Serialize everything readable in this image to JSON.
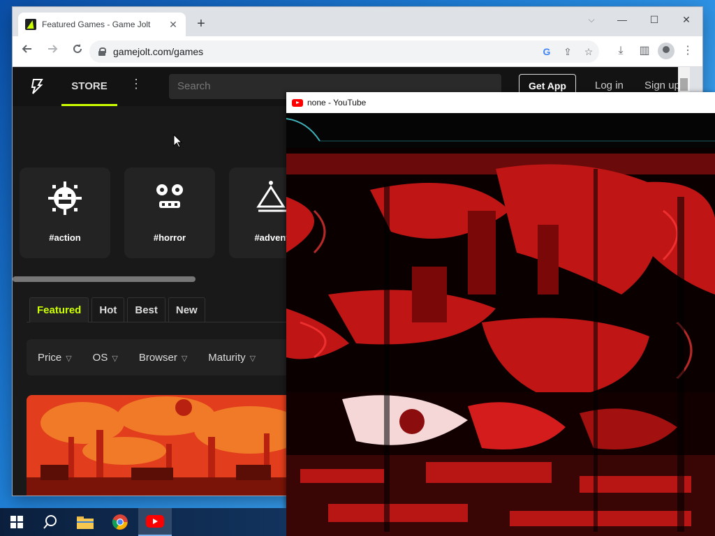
{
  "browser": {
    "tab_title": "Featured Games - Game Jolt",
    "tab_close": "✕",
    "new_tab": "+",
    "url": "gamejolt.com/games",
    "win_dropdown": "⌵",
    "win_min": "—",
    "win_max": "☐",
    "win_close": "✕"
  },
  "gamejolt": {
    "store_label": "STORE",
    "more_label": "⋮",
    "search_placeholder": "Search",
    "get_app_label": "Get App",
    "login_label": "Log in",
    "signup_label": "Sign up",
    "tags": [
      "#action",
      "#horror",
      "#adventu"
    ],
    "feed_tabs": [
      "Featured",
      "Hot",
      "Best",
      "New"
    ],
    "active_tab": "Featured",
    "filters": [
      "Price",
      "OS",
      "Browser",
      "Maturity"
    ],
    "accent_color": "#ccff00"
  },
  "youtube_window": {
    "title": "none - YouTube"
  },
  "taskbar": {
    "items": [
      "start-icon",
      "search-icon",
      "file-explorer-icon",
      "chrome-icon",
      "youtube-icon"
    ],
    "active": "youtube-icon"
  }
}
